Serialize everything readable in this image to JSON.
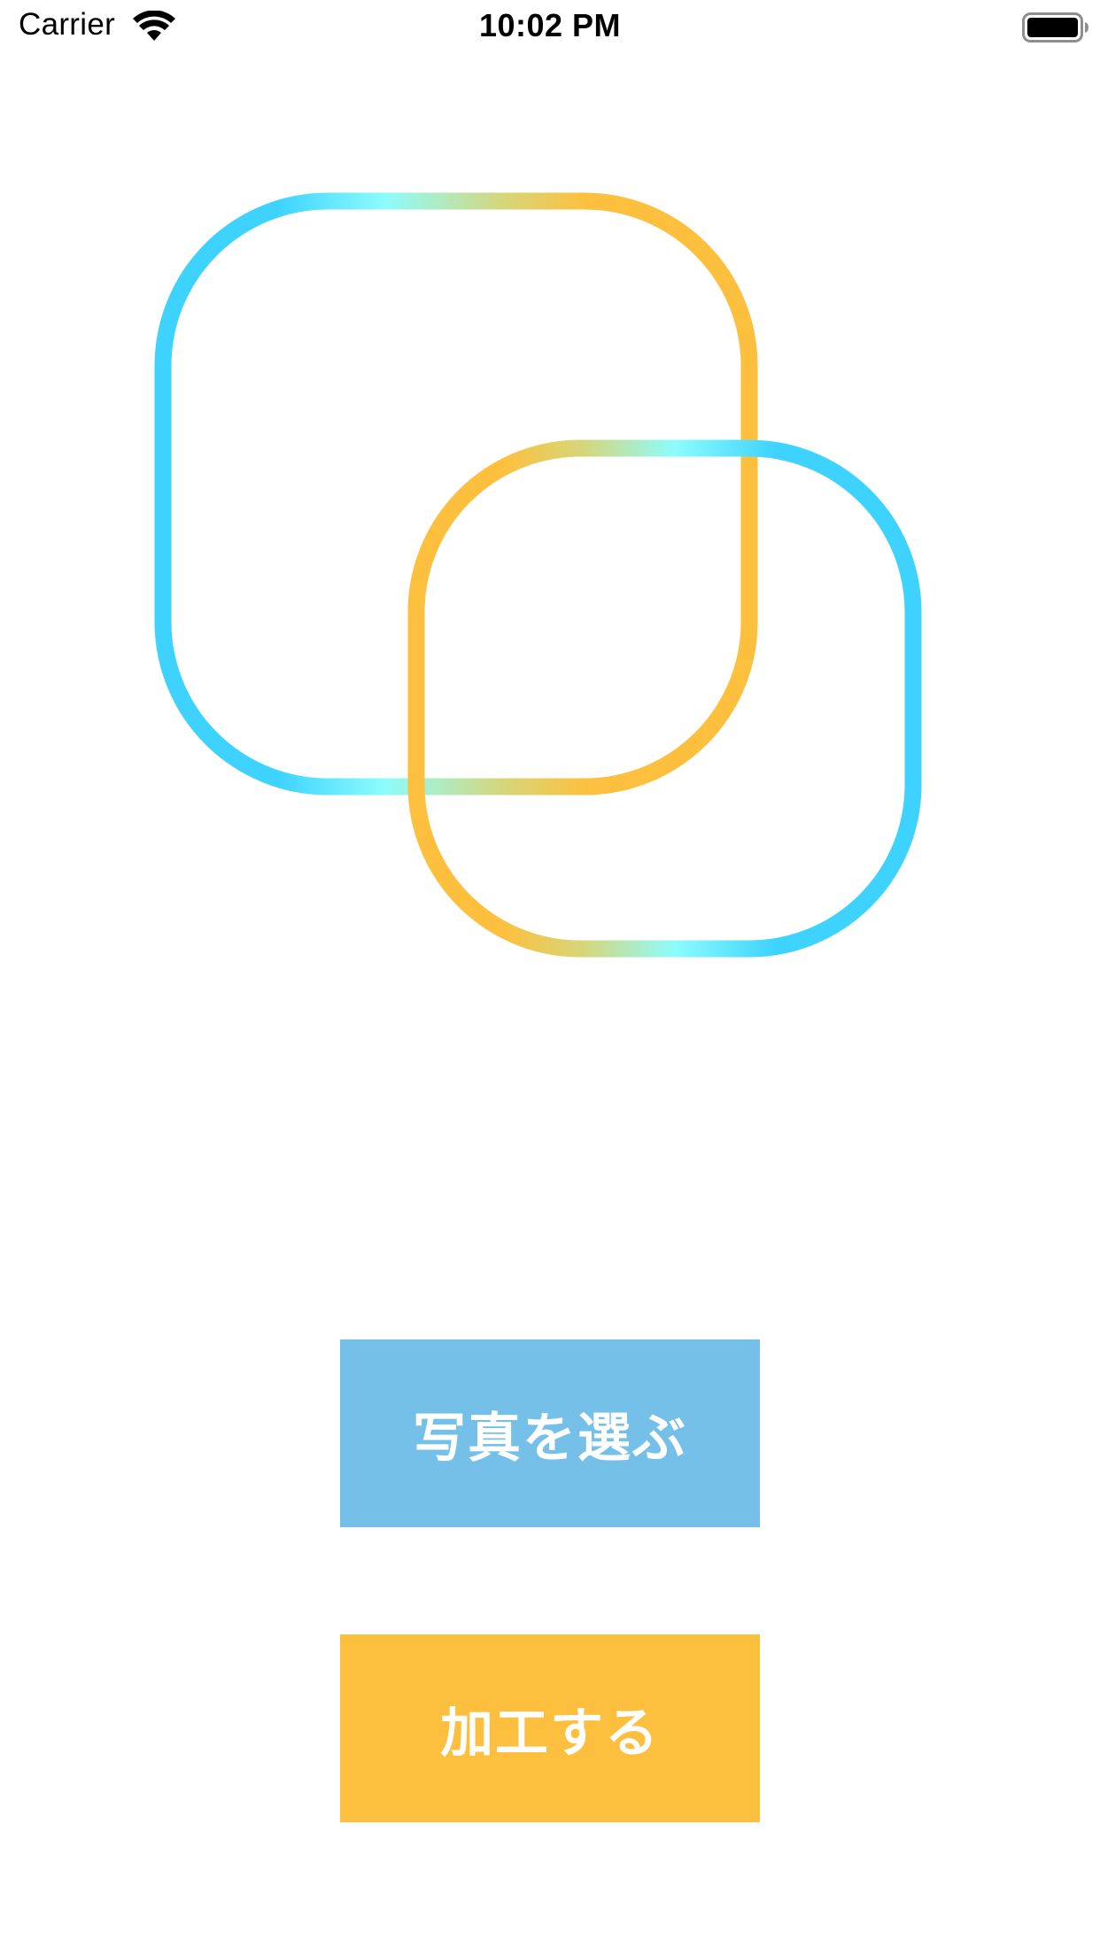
{
  "status_bar": {
    "carrier": "Carrier",
    "time": "10:02 PM",
    "icons": [
      "wifi-icon",
      "battery-icon"
    ]
  },
  "logo": {
    "name": "overlapping-rounded-squares-logo",
    "colors": {
      "blue": "#3ed3fe",
      "cyan": "#8dfcfd",
      "orange": "#fdc03e"
    }
  },
  "buttons": {
    "choose_photo": {
      "label": "写真を選ぶ",
      "color": "#75c0e8"
    },
    "process": {
      "label": "加工する",
      "color": "#fdbf3e"
    }
  }
}
